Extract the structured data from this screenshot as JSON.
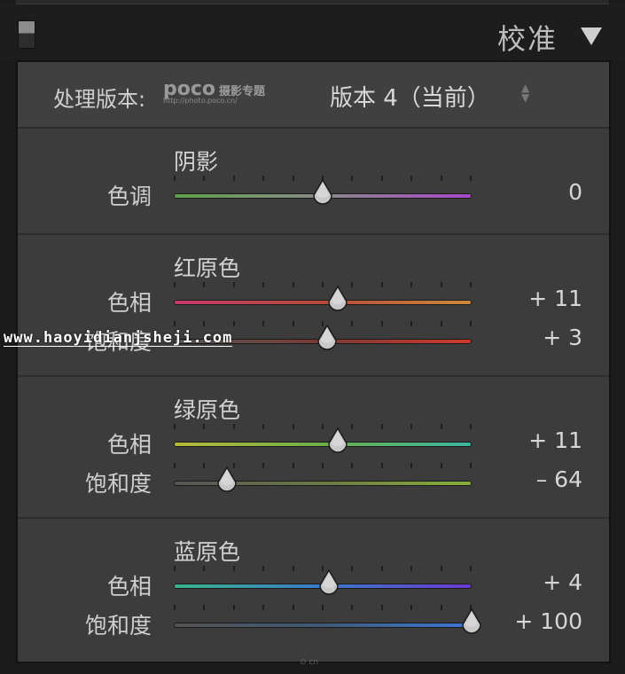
{
  "panel": {
    "title": "校准"
  },
  "process": {
    "label": "处理版本:",
    "logo_text": "poco",
    "logo_sub": "摄影专题",
    "logo_url": "http://photo.poco.cn/",
    "value": "版本 4（当前）",
    "updown": "◆"
  },
  "sections": [
    {
      "title": "阴影",
      "rows": [
        {
          "label": "色调",
          "value": "0",
          "fraction": 0.5,
          "gradient": [
            "#5fa24a",
            "#8a8a8a",
            "#a848c8"
          ]
        }
      ]
    },
    {
      "title": "红原色",
      "rows": [
        {
          "label": "色相",
          "value": "+ 11",
          "fraction": 0.55,
          "gradient": [
            "#c23a6a",
            "#b54a3a",
            "#c98a3c"
          ]
        },
        {
          "label": "饱和度",
          "value": "+ 3",
          "fraction": 0.515,
          "gradient": [
            "#555555",
            "#7a3a33",
            "#cf3a2e"
          ]
        }
      ]
    },
    {
      "title": "绿原色",
      "rows": [
        {
          "label": "色相",
          "value": "+ 11",
          "fraction": 0.55,
          "gradient": [
            "#b8b83a",
            "#6cb04a",
            "#3ab4a0"
          ]
        },
        {
          "label": "饱和度",
          "value": "– 64",
          "fraction": 0.18,
          "gradient": [
            "#555555",
            "#6a7a44",
            "#8ab03a"
          ]
        }
      ]
    },
    {
      "title": "蓝原色",
      "rows": [
        {
          "label": "色相",
          "value": "+ 4",
          "fraction": 0.52,
          "gradient": [
            "#3ab48a",
            "#3a7ac8",
            "#6a3ad0"
          ]
        },
        {
          "label": "饱和度",
          "value": "+ 100",
          "fraction": 1.0,
          "gradient": [
            "#555555",
            "#3f5a78",
            "#3a78d8"
          ]
        }
      ]
    }
  ],
  "watermark": "www.haoyidianjsheji.com",
  "bottom_mark": "⊙ cn"
}
